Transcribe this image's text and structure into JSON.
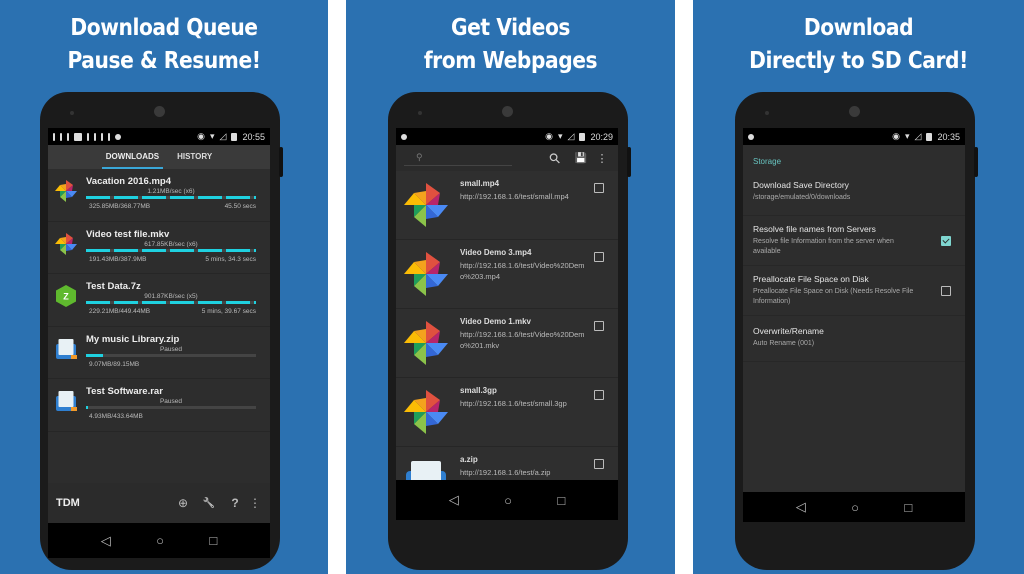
{
  "panels": [
    {
      "headline": [
        "Download Queue",
        "Pause & Resume!"
      ],
      "status_time": "20:55",
      "tabs": [
        {
          "label": "DOWNLOADS",
          "active": true
        },
        {
          "label": "HISTORY",
          "active": false
        }
      ],
      "downloads": [
        {
          "name": "Vacation 2016.mp4",
          "speed": "1.21MB/sec (x6)",
          "size": "325.85MB/368.77MB",
          "eta": "45.50 secs",
          "progress": 0.88,
          "segmented": true,
          "icon": "pinwheel-icon"
        },
        {
          "name": "Video test file.mkv",
          "speed": "617.85KB/sec (x6)",
          "size": "191.43MB/387.9MB",
          "eta": "5 mins, 34.3 secs",
          "progress": 0.49,
          "segmented": true,
          "icon": "pinwheel-icon"
        },
        {
          "name": "Test Data.7z",
          "speed": "901.87KB/sec (x5)",
          "size": "229.21MB/449.44MB",
          "eta": "5 mins, 39.67 secs",
          "progress": 0.51,
          "segmented": true,
          "icon": "zarchiver-icon"
        },
        {
          "name": "My music Library.zip",
          "speed": "Paused",
          "size": "9.07MB/89.15MB",
          "eta": "",
          "progress": 0.1,
          "segmented": false,
          "icon": "archive-box-icon"
        },
        {
          "name": "Test Software.rar",
          "speed": "Paused",
          "size": "4.93MB/433.64MB",
          "eta": "",
          "progress": 0.01,
          "segmented": false,
          "icon": "archive-box-icon"
        }
      ],
      "bottombar": {
        "title": "TDM",
        "add": "⊕",
        "tools": "🔧",
        "help": "?",
        "more": "⋮"
      }
    },
    {
      "headline": [
        "Get Videos",
        "from Webpages"
      ],
      "status_time": "20:29",
      "search": {
        "placeholder": "",
        "search_icon": "⚲",
        "save_icon": "💾",
        "more": "⋮"
      },
      "videos": [
        {
          "name": "small.mp4",
          "url": "http://192.168.1.6/test/small.mp4",
          "checked": false
        },
        {
          "name": "Video Demo 3.mp4",
          "url": "http://192.168.1.6/test/Video%20Demo%203.mp4",
          "checked": false
        },
        {
          "name": "Video Demo 1.mkv",
          "url": "http://192.168.1.6/test/Video%20Demo%201.mkv",
          "checked": false
        },
        {
          "name": "small.3gp",
          "url": "http://192.168.1.6/test/small.3gp",
          "checked": false
        },
        {
          "name": "a.zip",
          "url": "http://192.168.1.6/test/a.zip",
          "checked": false
        }
      ]
    },
    {
      "headline": [
        "Download",
        "Directly to SD Card!"
      ],
      "status_time": "20:35",
      "section": "Storage",
      "settings": [
        {
          "title": "Download Save Directory",
          "sub": "/storage/emulated/0/downloads",
          "checkbox": null
        },
        {
          "title": "Resolve file names from Servers",
          "sub": "Resolve file Information from the server when available",
          "checkbox": true
        },
        {
          "title": "Preallocate File Space on Disk",
          "sub": "Preallocate File Space on Disk (Needs Resolve File Information)",
          "checkbox": false
        },
        {
          "title": "Overwrite/Rename",
          "sub": "Auto Rename (001)",
          "checkbox": null
        }
      ]
    }
  ],
  "navbar": {
    "back": "◁",
    "home": "○",
    "recents": "□"
  },
  "colors": {
    "background": "#2b71b1",
    "accent": "#1fd1e0",
    "section": "#67c3bf"
  }
}
